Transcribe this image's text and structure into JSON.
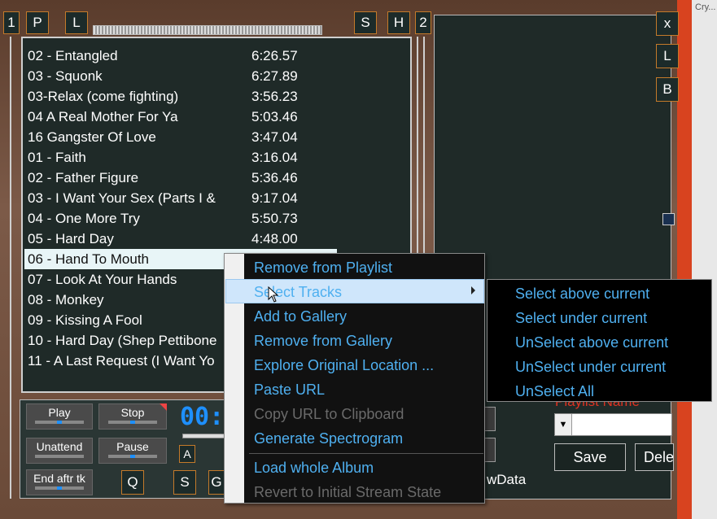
{
  "top_buttons": {
    "one": "1",
    "p": "P",
    "l": "L",
    "s": "S",
    "h": "H",
    "two": "2"
  },
  "side_buttons": {
    "x": "x",
    "l": "L",
    "b": "B"
  },
  "partial_window_title": "Cry...",
  "playlist": {
    "tracks": [
      {
        "title": "02 - Entangled",
        "duration": "6:26.57"
      },
      {
        "title": "03 - Squonk",
        "duration": "6:27.89"
      },
      {
        "title": "03-Relax (come fighting)",
        "duration": "3:56.23"
      },
      {
        "title": "04 A Real Mother For Ya",
        "duration": "5:03.46"
      },
      {
        "title": "16 Gangster Of Love",
        "duration": "3:47.04"
      },
      {
        "title": "01 - Faith",
        "duration": "3:16.04"
      },
      {
        "title": "02 - Father Figure",
        "duration": "5:36.46"
      },
      {
        "title": "03 - I Want Your Sex (Parts I &",
        "duration": "9:17.04"
      },
      {
        "title": "04 - One More Try",
        "duration": "5:50.73"
      },
      {
        "title": "05 - Hard Day",
        "duration": "4:48.00"
      },
      {
        "title": "06 - Hand To Mouth",
        "duration": ""
      },
      {
        "title": "07 - Look At Your Hands",
        "duration": ""
      },
      {
        "title": "08 - Monkey",
        "duration": ""
      },
      {
        "title": "09 - Kissing A Fool",
        "duration": ""
      },
      {
        "title": "10 - Hard Day (Shep Pettibone",
        "duration": ""
      },
      {
        "title": "11 - A Last Request (I Want Yo",
        "duration": ""
      }
    ],
    "selected_index": 10
  },
  "controls": {
    "play": "Play",
    "stop": "Stop",
    "unattend": "Unattend",
    "pause": "Pause",
    "end_after_track": "End aftr tk",
    "q": "Q",
    "s": "S",
    "g": "G",
    "a": "A",
    "time_display": "00:"
  },
  "right_panel": {
    "playlist_name_label": "Playlist Name",
    "save": "Save",
    "delete": "Dele",
    "raw_data": "wData"
  },
  "context_menu": {
    "items": [
      {
        "label": "Remove from Playlist",
        "enabled": true
      },
      {
        "label": "Select Tracks",
        "enabled": true,
        "highlighted": true,
        "has_submenu": true
      },
      {
        "label": "Add to Gallery",
        "enabled": true
      },
      {
        "label": "Remove from Gallery",
        "enabled": true
      },
      {
        "label": "Explore Original Location ...",
        "enabled": true
      },
      {
        "label": "Paste URL",
        "enabled": true
      },
      {
        "label": "Copy URL to Clipboard",
        "enabled": false
      },
      {
        "label": "Generate Spectrogram",
        "enabled": true
      },
      {
        "label": "Load whole Album",
        "enabled": true
      },
      {
        "label": "Revert to Initial Stream State",
        "enabled": false
      }
    ],
    "submenu": [
      "Select above current",
      "Select under current",
      "UnSelect above current",
      "UnSelect under current",
      "UnSelect All"
    ]
  },
  "colors": {
    "accent": "#4fb0f0",
    "orange_border": "#c47a2a",
    "panel": "#1f2a28",
    "red_bar": "#d8431f"
  }
}
